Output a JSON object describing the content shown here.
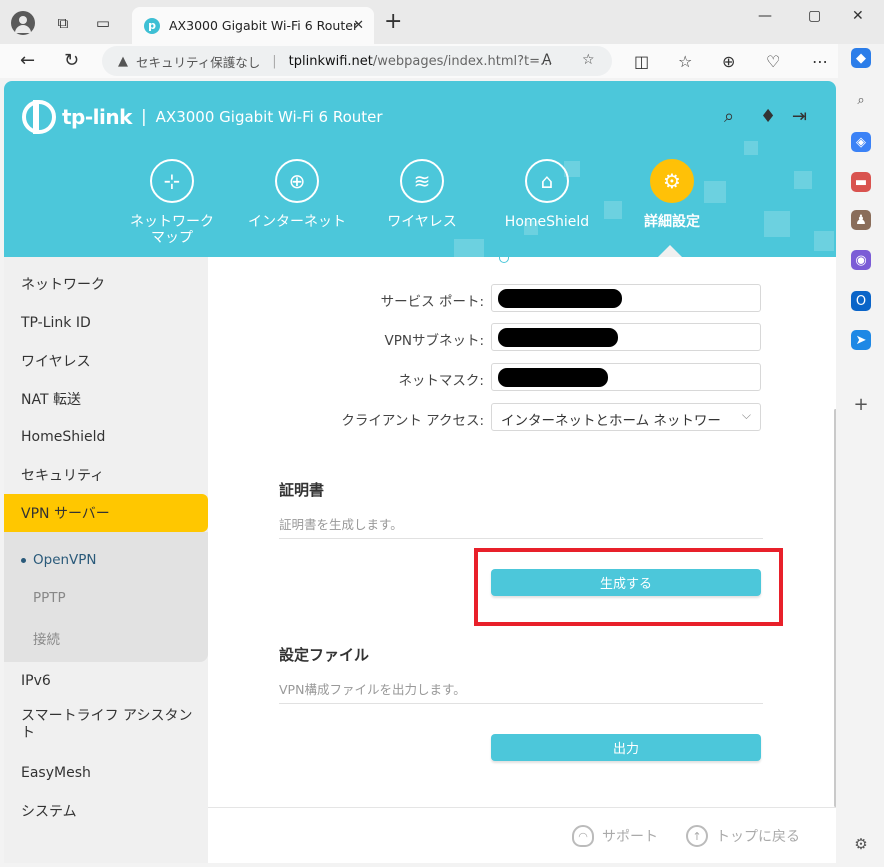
{
  "browser": {
    "tab_title": "AX3000 Gigabit Wi-Fi 6 Router",
    "tab_favicon": "tp",
    "security_label": "セキュリティ保護なし",
    "url_host": "tplinkwifi.net",
    "url_rest": "/webpages/index.html?t=..."
  },
  "header": {
    "brand": "tp-link",
    "separator": "|",
    "model": "AX3000 Gigabit Wi-Fi 6 Router"
  },
  "topnav": [
    {
      "label": "ネットワーク\nマップ",
      "icon": "network-map-icon"
    },
    {
      "label": "インターネット",
      "icon": "globe-icon"
    },
    {
      "label": "ワイヤレス",
      "icon": "wifi-icon"
    },
    {
      "label": "HomeShield",
      "icon": "homeshield-icon"
    },
    {
      "label": "詳細設定",
      "icon": "gear-icon",
      "active": true
    }
  ],
  "sidebar": {
    "items": [
      "ネットワーク",
      "TP-Link ID",
      "ワイヤレス",
      "NAT 転送",
      "HomeShield",
      "セキュリティ",
      "VPN サーバー",
      "IPv6",
      "スマートライフ アシスタント",
      "EasyMesh",
      "システム"
    ],
    "active": "VPN サーバー",
    "subitems": [
      "OpenVPN",
      "PPTP",
      "接続"
    ],
    "active_sub": "OpenVPN"
  },
  "form": {
    "service_port_label": "サービス ポート:",
    "vpn_subnet_label": "VPNサブネット:",
    "netmask_label": "ネットマスク:",
    "client_access_label": "クライアント アクセス:",
    "client_access_value": "インターネットとホーム ネットワー"
  },
  "certificate": {
    "title": "証明書",
    "description": "証明書を生成します。",
    "button": "生成する"
  },
  "config_file": {
    "title": "設定ファイル",
    "description": "VPN構成ファイルを出力します。",
    "button": "出力"
  },
  "footer": {
    "support": "サポート",
    "back_to_top": "トップに戻る"
  },
  "colors": {
    "header": "#4cc7da",
    "active_menu": "#ffc700",
    "button": "#4cc7da",
    "highlight": "#e8202a"
  }
}
